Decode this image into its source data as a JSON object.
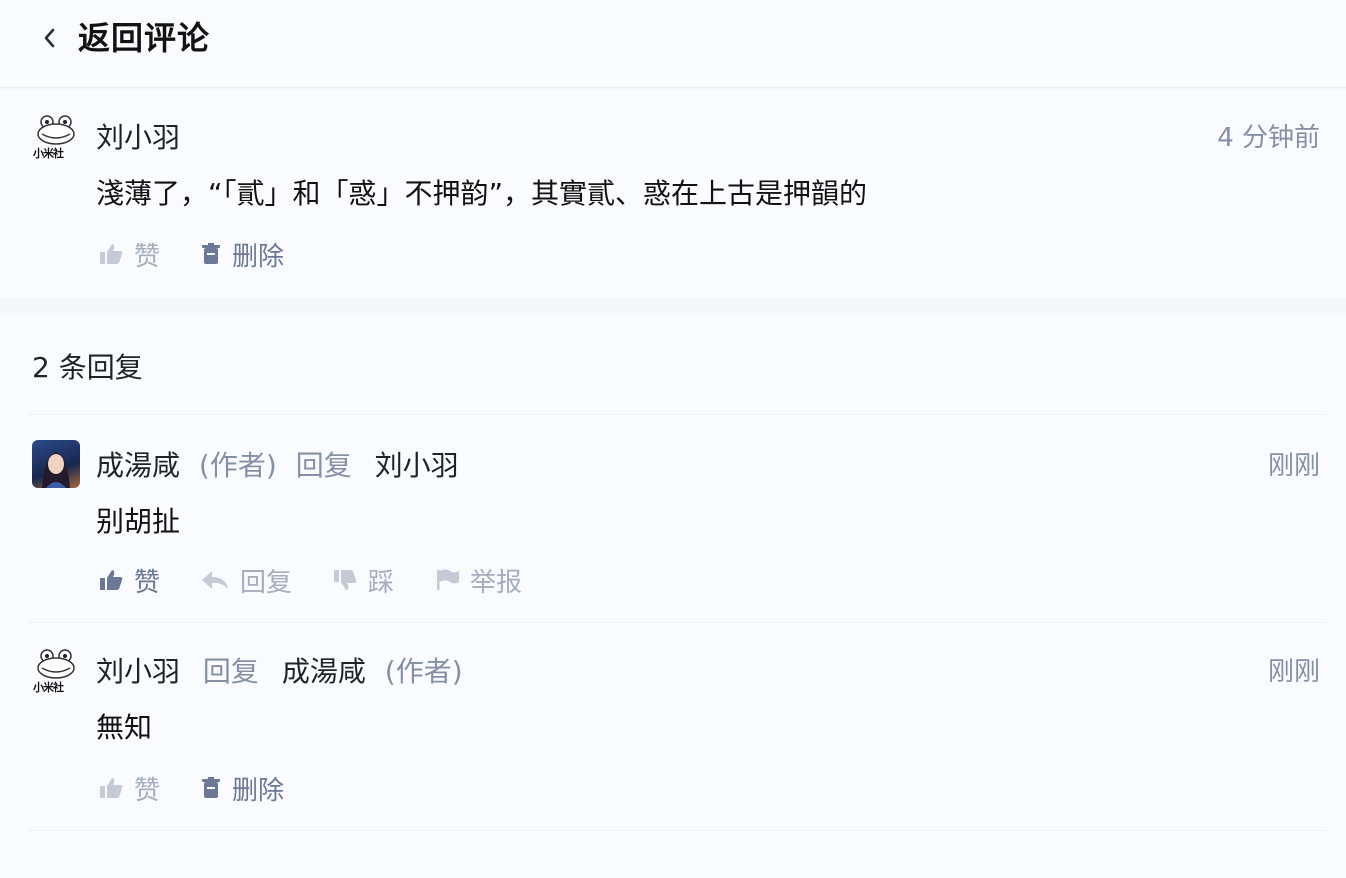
{
  "header": {
    "title": "返回评论"
  },
  "main_comment": {
    "author": "刘小羽",
    "time": "4 分钟前",
    "text": "淺薄了，“「貳」和「惑」不押韵”，其實貳、惑在上古是押韻的",
    "actions": {
      "like": "赞",
      "delete": "删除"
    }
  },
  "replies_header": {
    "count_label": "2 条回复"
  },
  "replies": [
    {
      "author": "成湯咸",
      "author_tag": "(作者)",
      "reply_word": "回复",
      "reply_to": "刘小羽",
      "time": "刚刚",
      "text": "别胡扯",
      "actions": {
        "like": "赞",
        "reply": "回复",
        "dislike": "踩",
        "report": "举报"
      }
    },
    {
      "author": "刘小羽",
      "reply_word": "回复",
      "reply_to": "成湯咸",
      "reply_to_tag": "(作者)",
      "time": "刚刚",
      "text": "無知",
      "actions": {
        "like": "赞",
        "delete": "删除"
      }
    }
  ],
  "avatar_badge_text": "小米社",
  "colors": {
    "muted": "#8590a6",
    "icon_light": "#c4cad6",
    "icon_dark": "#6b7896"
  }
}
